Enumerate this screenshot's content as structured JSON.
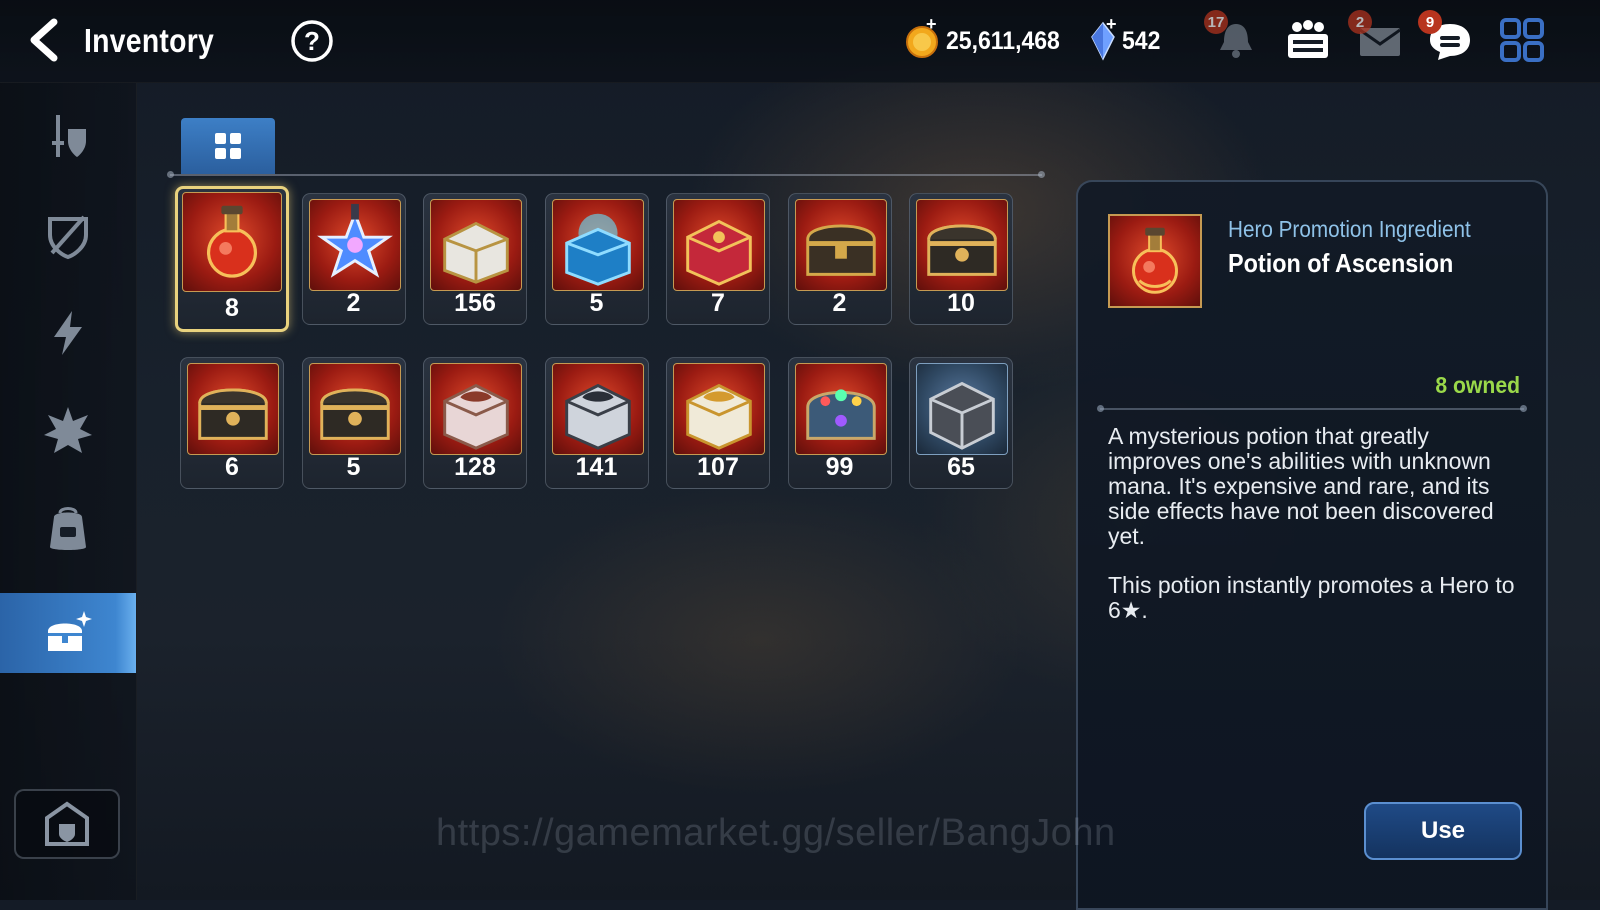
{
  "header": {
    "title": "Inventory",
    "gold": "25,611,468",
    "crystals": "542",
    "notification_count": "17",
    "mail_count": "2",
    "chat_count": "9"
  },
  "sidebar": {
    "items": [
      {
        "name": "equipment"
      },
      {
        "name": "artifacts"
      },
      {
        "name": "materials"
      },
      {
        "name": "catalysts"
      },
      {
        "name": "bag"
      },
      {
        "name": "chests",
        "active": true
      }
    ],
    "storage": "storage"
  },
  "filter": {
    "active_tab": "all"
  },
  "items": [
    {
      "icon": "potion-icon",
      "qty": "8"
    },
    {
      "icon": "star-potion-icon",
      "qty": "2"
    },
    {
      "icon": "white-chest-icon",
      "qty": "156"
    },
    {
      "icon": "blue-chest-icon",
      "qty": "5"
    },
    {
      "icon": "red-chest-icon",
      "qty": "7"
    },
    {
      "icon": "dark-chest-icon",
      "qty": "2"
    },
    {
      "icon": "gold-chest-icon",
      "qty": "10"
    },
    {
      "icon": "gold-chest-icon",
      "qty": "6"
    },
    {
      "icon": "gold-chest-icon",
      "qty": "5"
    },
    {
      "icon": "pink-cube-chest-icon",
      "qty": "128"
    },
    {
      "icon": "silver-cube-chest-icon",
      "qty": "141"
    },
    {
      "icon": "gold-cube-chest-icon",
      "qty": "107"
    },
    {
      "icon": "jeweled-chest-icon",
      "qty": "99"
    },
    {
      "icon": "iron-cube-icon",
      "qty": "65"
    }
  ],
  "detail": {
    "category": "Hero Promotion Ingredient",
    "name": "Potion of Ascension",
    "owned": "8 owned",
    "description_1": "A mysterious potion that greatly improves one's abilities with unknown mana. It's expensive and rare, and its side effects have not been discovered yet.",
    "description_2": "This potion instantly promotes a Hero to 6★.",
    "use_label": "Use"
  },
  "watermark": "https://gamemarket.gg/seller/BangJohn",
  "colors": {
    "accent": "#3e86d0",
    "owned": "#9ad84a",
    "selected_border": "#e9d27e"
  }
}
